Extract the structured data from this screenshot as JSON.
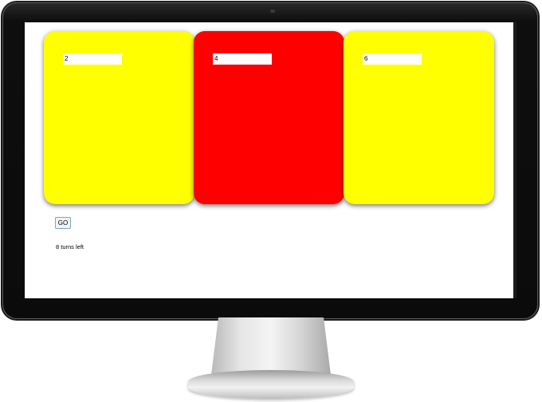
{
  "cards": [
    {
      "value": "2",
      "color": "#ffff00"
    },
    {
      "value": "4",
      "color": "#ff0000"
    },
    {
      "value": "6",
      "color": "#ffff00"
    }
  ],
  "go_button": {
    "label": "GO"
  },
  "status": {
    "turns_text": "8 turns left"
  },
  "colors": {
    "bezel": "#0b0b0b",
    "screen": "#ffffff",
    "button_border": "#7aa3c9"
  }
}
